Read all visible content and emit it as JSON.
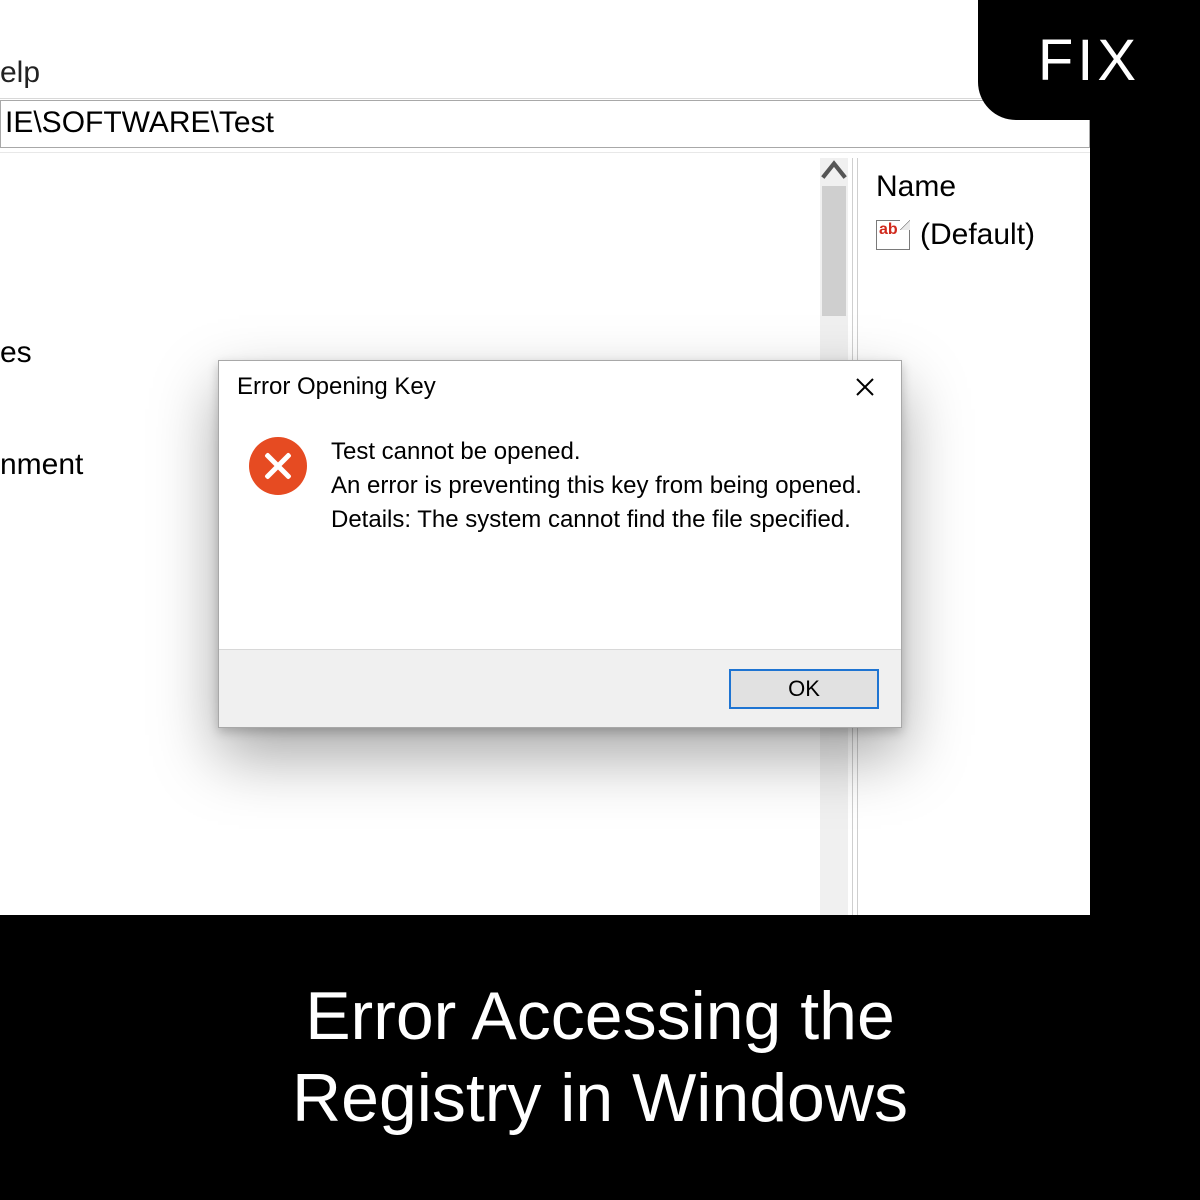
{
  "badge": {
    "label": "FIX"
  },
  "menubar": {
    "help_fragment": "elp"
  },
  "path": "IE\\SOFTWARE\\Test",
  "tree": {
    "item_es": "es",
    "item_nment": "nment"
  },
  "rightpane": {
    "name_header": "Name",
    "default_value": "(Default)"
  },
  "dialog": {
    "title": "Error Opening Key",
    "line1": "Test cannot be opened.",
    "line2": "An error is preventing this key from being opened.",
    "line3": "Details: The system cannot find the file specified.",
    "ok_label": "OK"
  },
  "caption": {
    "line1": "Error Accessing the",
    "line2": "Registry in Windows"
  }
}
